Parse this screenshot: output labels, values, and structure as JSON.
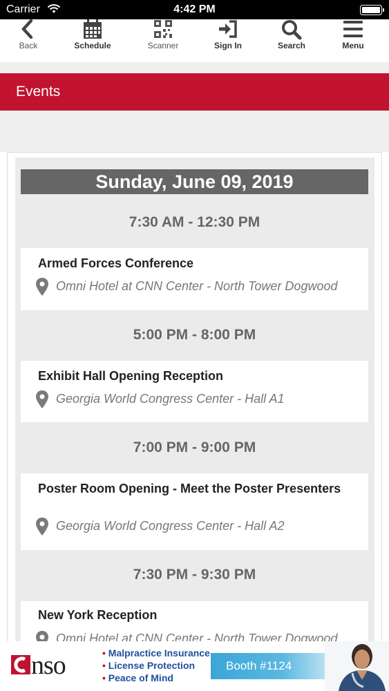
{
  "status_bar": {
    "carrier": "Carrier",
    "time": "4:42 PM"
  },
  "nav": {
    "back": "Back",
    "schedule": "Schedule",
    "scanner": "Scanner",
    "sign_in": "Sign In",
    "search": "Search",
    "menu": "Menu"
  },
  "header": {
    "title": "Events"
  },
  "schedule": {
    "date": "Sunday, June 09, 2019",
    "slots": [
      {
        "time": "7:30 AM - 12:30 PM",
        "event": "Armed Forces Conference",
        "location": "Omni Hotel at CNN Center - North Tower Dogwood"
      },
      {
        "time": "5:00 PM - 8:00 PM",
        "event": "Exhibit Hall Opening Reception",
        "location": "Georgia World Congress Center - Hall A1"
      },
      {
        "time": "7:00 PM - 9:00 PM",
        "event": "Poster Room Opening - Meet the Poster Presenters",
        "location": "Georgia World Congress Center - Hall A2"
      },
      {
        "time": "7:30 PM - 9:30 PM",
        "event": "New York Reception",
        "location": "Omni Hotel at CNN Center - North Tower Dogwood"
      }
    ]
  },
  "ad": {
    "brand": "nso",
    "bullets": [
      "Malpractice Insurance",
      "License Protection",
      "Peace of Mind"
    ],
    "booth": "Booth #1124"
  },
  "colors": {
    "accent_red": "#c1122f",
    "date_bar": "#666666",
    "booth_blue": "#3aa6d8",
    "bullet_blue": "#1e4f9c"
  },
  "icons": {
    "nav": [
      "chevron-left-icon",
      "calendar-icon",
      "qr-code-icon",
      "sign-in-icon",
      "search-icon",
      "hamburger-menu-icon"
    ],
    "location": "map-pin-icon"
  }
}
